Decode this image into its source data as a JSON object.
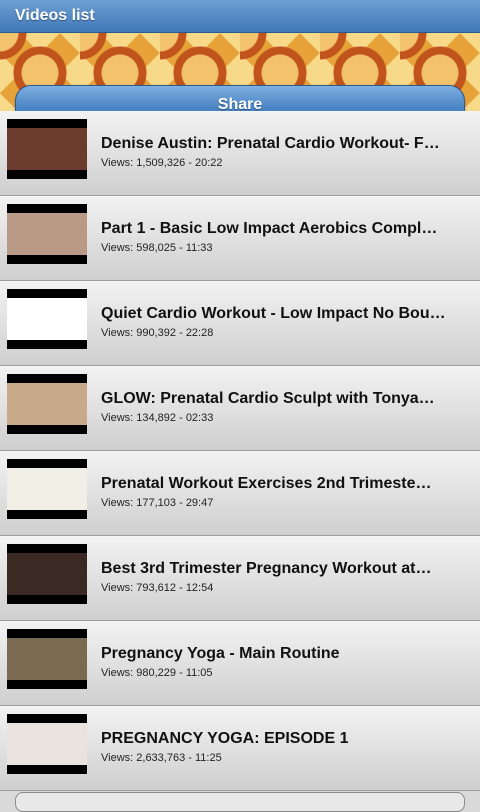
{
  "app": {
    "title": "Videos list"
  },
  "toolbar": {
    "share_label": "Share"
  },
  "videos": [
    {
      "title": "Denise Austin: Prenatal Cardio Workout- F…",
      "views_label": "Views: ",
      "views": "1,509,326",
      "sep": " - ",
      "duration": "20:22",
      "thumb_bg": "#6b3b2e"
    },
    {
      "title": "Part 1 - Basic Low Impact Aerobics Compl…",
      "views_label": "Views: ",
      "views": "598,025",
      "sep": " - ",
      "duration": "11:33",
      "thumb_bg": "#b89a86"
    },
    {
      "title": "Quiet Cardio Workout - Low Impact No Bou…",
      "views_label": "Views: ",
      "views": "990,392",
      "sep": " - ",
      "duration": "22:28",
      "thumb_bg": "#ffffff"
    },
    {
      "title": "GLOW: Prenatal Cardio Sculpt with Tonya…",
      "views_label": "Views: ",
      "views": "134,892",
      "sep": " - ",
      "duration": "02:33",
      "thumb_bg": "#c8a98a"
    },
    {
      "title": "Prenatal Workout Exercises 2nd Trimeste…",
      "views_label": "Views: ",
      "views": "177,103",
      "sep": " - ",
      "duration": "29:47",
      "thumb_bg": "#f1eee6"
    },
    {
      "title": "Best 3rd Trimester Pregnancy Workout at…",
      "views_label": "Views: ",
      "views": "793,612",
      "sep": " - ",
      "duration": "12:54",
      "thumb_bg": "#3b2a24"
    },
    {
      "title": "Pregnancy Yoga - Main Routine",
      "views_label": "Views: ",
      "views": "980,229",
      "sep": " - ",
      "duration": "11:05",
      "thumb_bg": "#7a6a52"
    },
    {
      "title": "PREGNANCY YOGA: EPISODE 1",
      "views_label": "Views: ",
      "views": "2,633,763",
      "sep": " - ",
      "duration": "11:25",
      "thumb_bg": "#e9e4de"
    }
  ]
}
